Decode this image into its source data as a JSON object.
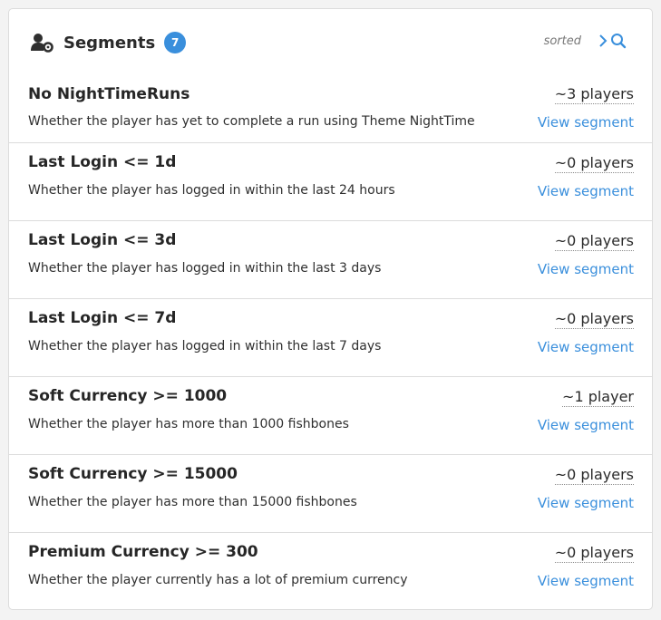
{
  "header": {
    "title": "Segments",
    "count": "7",
    "sort_label": "sorted",
    "icons": {
      "title_icon": "users-gear-icon",
      "expand_icon": "chevron-right-icon",
      "search_icon": "search-icon"
    }
  },
  "colors": {
    "accent": "#3a8fdc",
    "text": "#2a2a2a",
    "divider": "#dcdcdc"
  },
  "segments": [
    {
      "name": "No NightTimeRuns",
      "description": "Whether the player has yet to complete a run using Theme NightTime",
      "count": "~3 players",
      "link": "View segment"
    },
    {
      "name": "Last Login <= 1d",
      "description": "Whether the player has logged in within the last 24 hours",
      "count": "~0 players",
      "link": "View segment"
    },
    {
      "name": "Last Login <= 3d",
      "description": "Whether the player has logged in within the last 3 days",
      "count": "~0 players",
      "link": "View segment"
    },
    {
      "name": "Last Login <= 7d",
      "description": "Whether the player has logged in within the last 7 days",
      "count": "~0 players",
      "link": "View segment"
    },
    {
      "name": "Soft Currency >= 1000",
      "description": "Whether the player has more than 1000 fishbones",
      "count": "~1 player",
      "link": "View segment"
    },
    {
      "name": "Soft Currency >= 15000",
      "description": "Whether the player has more than 15000 fishbones",
      "count": "~0 players",
      "link": "View segment"
    },
    {
      "name": "Premium Currency >= 300",
      "description": "Whether the player currently has a lot of premium currency",
      "count": "~0 players",
      "link": "View segment"
    }
  ]
}
